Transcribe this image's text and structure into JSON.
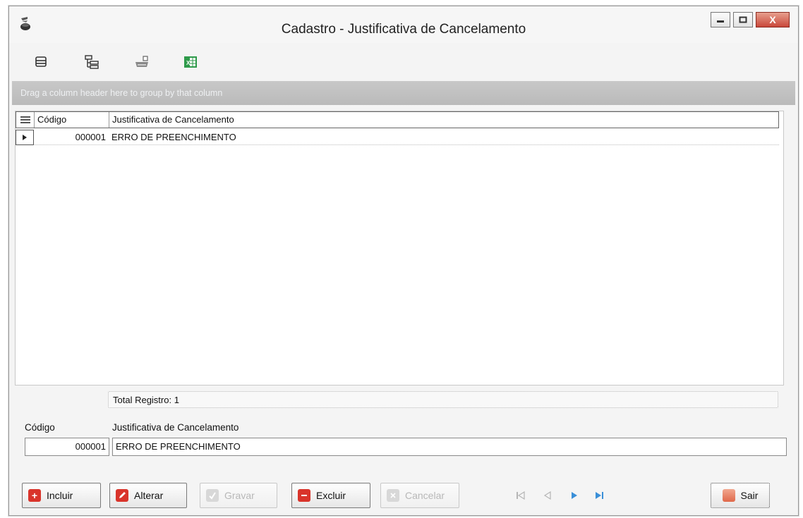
{
  "window": {
    "title": "Cadastro - Justificativa de Cancelamento",
    "controls": {
      "minimize": "minimize-icon",
      "maximize": "maximize-icon",
      "close": "X"
    }
  },
  "toolbar": {
    "icons": [
      "grid-columns-icon",
      "tree-view-icon",
      "print-icon",
      "excel-export-icon"
    ]
  },
  "group_panel": {
    "hint": "Drag a column header here to group by that column"
  },
  "grid": {
    "columns": [
      "Código",
      "Justificativa de Cancelamento"
    ],
    "rows": [
      {
        "codigo": "000001",
        "justificativa": "ERRO DE PREENCHIMENTO"
      }
    ],
    "footer": "Total Registro: 1"
  },
  "detail": {
    "codigo_label": "Código",
    "codigo_value": "000001",
    "justificativa_label": "Justificativa de Cancelamento",
    "justificativa_value": "ERRO DE PREENCHIMENTO"
  },
  "actions": {
    "incluir": "Incluir",
    "alterar": "Alterar",
    "gravar": "Gravar",
    "excluir": "Excluir",
    "cancelar": "Cancelar",
    "sair": "Sair"
  },
  "navigation": {
    "icons": [
      "first-record-icon",
      "previous-record-icon",
      "next-record-icon",
      "last-record-icon"
    ]
  },
  "colors": {
    "accent_red": "#d9342b",
    "excel_green": "#2e9a4a",
    "nav_blue": "#3a8fd8",
    "group_panel": "#c2c2c2"
  }
}
